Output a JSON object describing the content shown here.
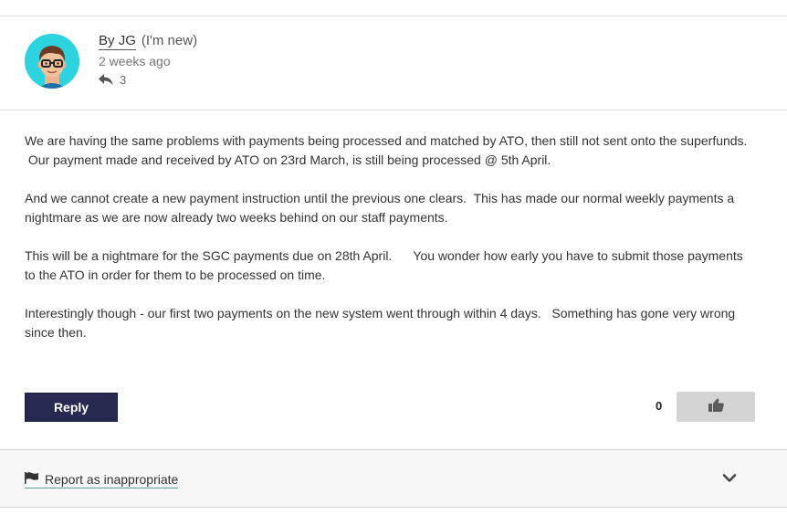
{
  "post": {
    "author_prefix": "By ",
    "author_name": "JG",
    "author_rank": "(I'm new)",
    "time": "2 weeks ago",
    "reply_count": "3"
  },
  "body": {
    "paragraphs": [
      "We are having the same problems with payments being processed and matched by ATO, then still not sent onto the superfunds.\n Our payment made and received by ATO on 23rd March, is still being processed @ 5th April.",
      "And we cannot create a new payment instruction until the previous one clears.  This has made our normal weekly payments a nightmare as we are now already two weeks behind on our staff payments.",
      "This will be a nightmare for the SGC payments due on 28th April.      You wonder how early you have to submit those payments to the ATO in order for them to be processed on time.",
      "Interestingly though - our first two payments on the new system went through within 4 days.   Something has gone very wrong since then."
    ]
  },
  "actions": {
    "reply_label": "Reply",
    "kudos_count": "0"
  },
  "footer": {
    "report_label": "Report as inappropriate"
  },
  "icons": {
    "avatar": "avatar-cartoon-face",
    "reply": "reply-arrow-icon",
    "kudos": "thumbs-up-icon",
    "report": "flag-icon",
    "expand": "chevron-down-icon"
  },
  "colors": {
    "avatar_bg": "#2ed3e0",
    "reply_button": "#262a50",
    "kudos_button": "#d4d4d4"
  }
}
